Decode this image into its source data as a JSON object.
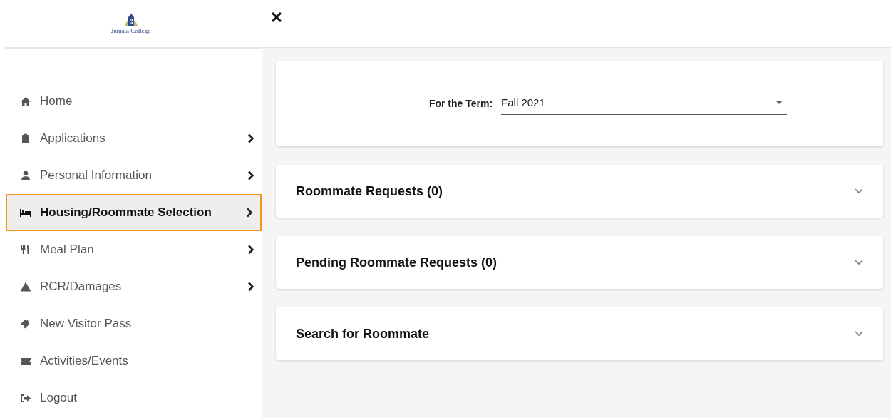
{
  "logo": {
    "name": "Juniata College"
  },
  "sidebar": {
    "items": [
      {
        "label": "Home",
        "has_submenu": false,
        "selected": false
      },
      {
        "label": "Applications",
        "has_submenu": true,
        "selected": false
      },
      {
        "label": "Personal Information",
        "has_submenu": true,
        "selected": false
      },
      {
        "label": "Housing/Roommate Selection",
        "has_submenu": true,
        "selected": true
      },
      {
        "label": "Meal Plan",
        "has_submenu": true,
        "selected": false
      },
      {
        "label": "RCR/Damages",
        "has_submenu": true,
        "selected": false
      },
      {
        "label": "New Visitor Pass",
        "has_submenu": false,
        "selected": false
      },
      {
        "label": "Activities/Events",
        "has_submenu": false,
        "selected": false
      },
      {
        "label": "Logout",
        "has_submenu": false,
        "selected": false
      }
    ]
  },
  "term": {
    "label": "For the Term:",
    "value": "Fall 2021"
  },
  "sections": [
    {
      "title": "Roommate Requests (0)",
      "expanded": false
    },
    {
      "title": "Pending Roommate Requests (0)",
      "expanded": false
    },
    {
      "title": "Search for Roommate",
      "expanded": false
    }
  ]
}
